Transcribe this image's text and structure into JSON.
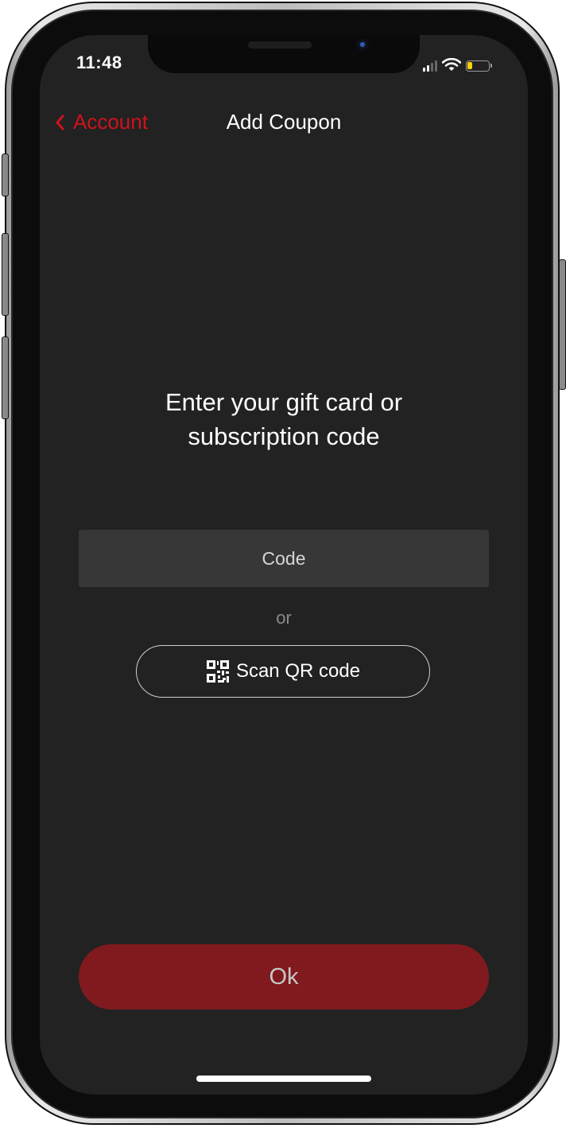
{
  "status_bar": {
    "time": "11:48",
    "battery_level": 0.25,
    "battery_color": "#f5d20c"
  },
  "nav": {
    "back_label": "Account",
    "title": "Add Coupon"
  },
  "prompt": {
    "line1": "Enter your gift card or",
    "line2": "subscription code"
  },
  "code_field": {
    "placeholder": "Code",
    "value": ""
  },
  "separator": "or",
  "scan_button": {
    "label": "Scan QR code",
    "icon": "qr-code-icon"
  },
  "ok_button": {
    "label": "Ok"
  },
  "colors": {
    "accent": "#d0121b",
    "ok_button": "#801a1e",
    "background": "#222222",
    "input_bg": "#373737"
  }
}
